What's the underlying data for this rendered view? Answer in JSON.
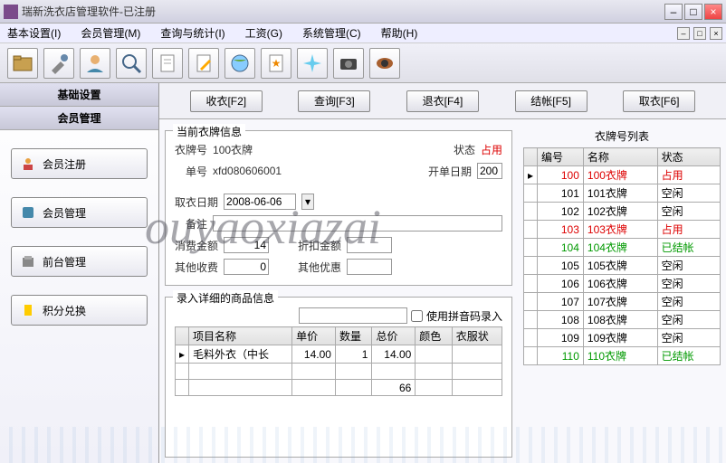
{
  "window": {
    "title": "瑞新洗衣店管理软件-已注册"
  },
  "menu": {
    "items": [
      "基本设置(I)",
      "会员管理(M)",
      "查询与统计(I)",
      "工资(G)",
      "系统管理(C)",
      "帮助(H)"
    ]
  },
  "sidebar": {
    "header1": "基础设置",
    "header2": "会员管理",
    "buttons": [
      {
        "label": "会员注册"
      },
      {
        "label": "会员管理"
      },
      {
        "label": "前台管理"
      },
      {
        "label": "积分兑换"
      }
    ]
  },
  "actions": {
    "receive": "收衣[F2]",
    "query": "查询[F3]",
    "return": "退衣[F4]",
    "settle": "结帐[F5]",
    "pickup": "取衣[F6]"
  },
  "tagInfo": {
    "title": "当前衣牌信息",
    "tagNoLabel": "衣牌号",
    "tagNo": "100衣牌",
    "statusLabel": "状态",
    "status": "占用",
    "orderNoLabel": "单号",
    "orderNo": "xfd080606001",
    "orderDateLabel": "开单日期",
    "orderDate": "200",
    "pickupDateLabel": "取衣日期",
    "pickupDate": "2008-06-06",
    "remarkLabel": "备注",
    "remark": "",
    "amountLabel": "消费金额",
    "amount": "14",
    "discountLabel": "折扣金额",
    "discount": "",
    "otherFeeLabel": "其他收费",
    "otherFee": "0",
    "otherDiscLabel": "其他优惠",
    "otherDisc": ""
  },
  "goods": {
    "title": "录入详细的商品信息",
    "pinyinLabel": "使用拼音码录入",
    "headers": {
      "name": "项目名称",
      "price": "单价",
      "qty": "数量",
      "total": "总价",
      "color": "颜色",
      "clothStatus": "衣服状"
    },
    "rows": [
      {
        "name": "毛料外衣（中长",
        "price": "14.00",
        "qty": "1",
        "total": "14.00",
        "color": "",
        "clothStatus": ""
      }
    ],
    "footerTotal": "66"
  },
  "tagList": {
    "title": "衣牌号列表",
    "headers": {
      "no": "编号",
      "name": "名称",
      "status": "状态"
    },
    "rows": [
      {
        "no": "100",
        "name": "100衣牌",
        "status": "占用",
        "cls": "red",
        "sel": true
      },
      {
        "no": "101",
        "name": "101衣牌",
        "status": "空闲",
        "cls": ""
      },
      {
        "no": "102",
        "name": "102衣牌",
        "status": "空闲",
        "cls": ""
      },
      {
        "no": "103",
        "name": "103衣牌",
        "status": "占用",
        "cls": "red"
      },
      {
        "no": "104",
        "name": "104衣牌",
        "status": "已结帐",
        "cls": "green"
      },
      {
        "no": "105",
        "name": "105衣牌",
        "status": "空闲",
        "cls": ""
      },
      {
        "no": "106",
        "name": "106衣牌",
        "status": "空闲",
        "cls": ""
      },
      {
        "no": "107",
        "name": "107衣牌",
        "status": "空闲",
        "cls": ""
      },
      {
        "no": "108",
        "name": "108衣牌",
        "status": "空闲",
        "cls": ""
      },
      {
        "no": "109",
        "name": "109衣牌",
        "status": "空闲",
        "cls": ""
      },
      {
        "no": "110",
        "name": "110衣牌",
        "status": "已结帐",
        "cls": "green"
      }
    ]
  },
  "watermark": "ouyaoxiazai"
}
